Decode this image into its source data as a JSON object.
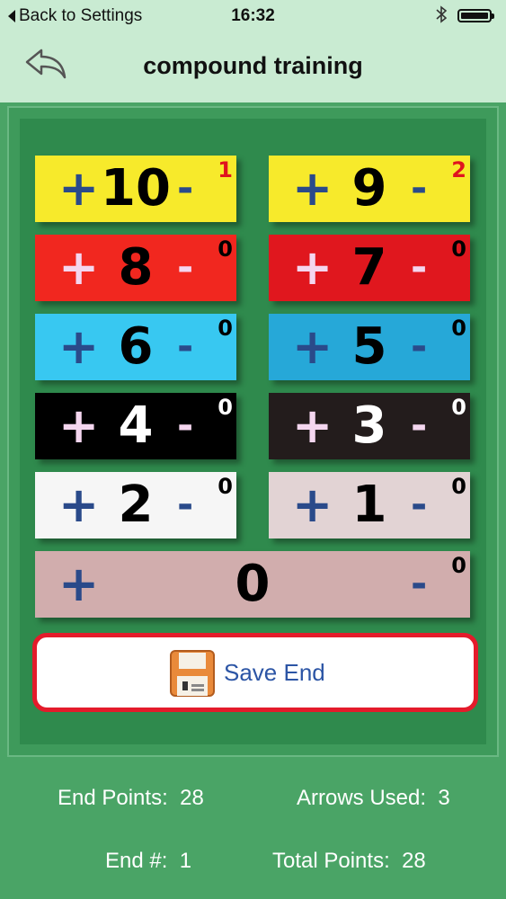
{
  "status_bar": {
    "back_label": "Back to Settings",
    "time": "16:32"
  },
  "nav": {
    "title": "compound training"
  },
  "score_buttons": [
    {
      "value": "10",
      "count": "1",
      "bg": "#f7ea2b",
      "sign_color": "#2a4a8a",
      "value_color": "#000000",
      "count_color": "#e0141e"
    },
    {
      "value": "9",
      "count": "2",
      "bg": "#f7ea2b",
      "sign_color": "#2a4a8a",
      "value_color": "#000000",
      "count_color": "#e0141e"
    },
    {
      "value": "8",
      "count": "0",
      "bg": "#f1271f",
      "sign_color": "#f4d6ef",
      "value_color": "#000000",
      "count_color": "#000000"
    },
    {
      "value": "7",
      "count": "0",
      "bg": "#e0171e",
      "sign_color": "#f4d6ef",
      "value_color": "#000000",
      "count_color": "#000000"
    },
    {
      "value": "6",
      "count": "0",
      "bg": "#38c8f1",
      "sign_color": "#2a4a8a",
      "value_color": "#000000",
      "count_color": "#000000"
    },
    {
      "value": "5",
      "count": "0",
      "bg": "#26a8d8",
      "sign_color": "#2a4a8a",
      "value_color": "#000000",
      "count_color": "#000000"
    },
    {
      "value": "4",
      "count": "0",
      "bg": "#000000",
      "sign_color": "#f4d6ef",
      "value_color": "#ffffff",
      "count_color": "#ffffff"
    },
    {
      "value": "3",
      "count": "0",
      "bg": "#231c1c",
      "sign_color": "#f4d6ef",
      "value_color": "#ffffff",
      "count_color": "#ffffff"
    },
    {
      "value": "2",
      "count": "0",
      "bg": "#f6f6f6",
      "sign_color": "#2a4a8a",
      "value_color": "#000000",
      "count_color": "#000000"
    },
    {
      "value": "1",
      "count": "0",
      "bg": "#e2d3d4",
      "sign_color": "#2a4a8a",
      "value_color": "#000000",
      "count_color": "#000000"
    },
    {
      "value": "0",
      "count": "0",
      "bg": "#d1adad",
      "sign_color": "#2a4a8a",
      "value_color": "#000000",
      "count_color": "#000000"
    }
  ],
  "plus_symbol": "+",
  "minus_symbol": "-",
  "save_button": {
    "label": "Save End",
    "icon": "floppy-disk-icon"
  },
  "stats": {
    "end_points_label": "End Points:",
    "end_points_value": "28",
    "arrows_used_label": "Arrows Used:",
    "arrows_used_value": "3",
    "end_number_label": "End #:",
    "end_number_value": "1",
    "total_points_label": "Total Points:",
    "total_points_value": "28"
  },
  "colors": {
    "bar_bg": "#c9ebd2",
    "board_green": "#2f8a4d",
    "footer_green": "#4aa466",
    "save_border": "#e41b2b",
    "save_text": "#2c55a5"
  }
}
